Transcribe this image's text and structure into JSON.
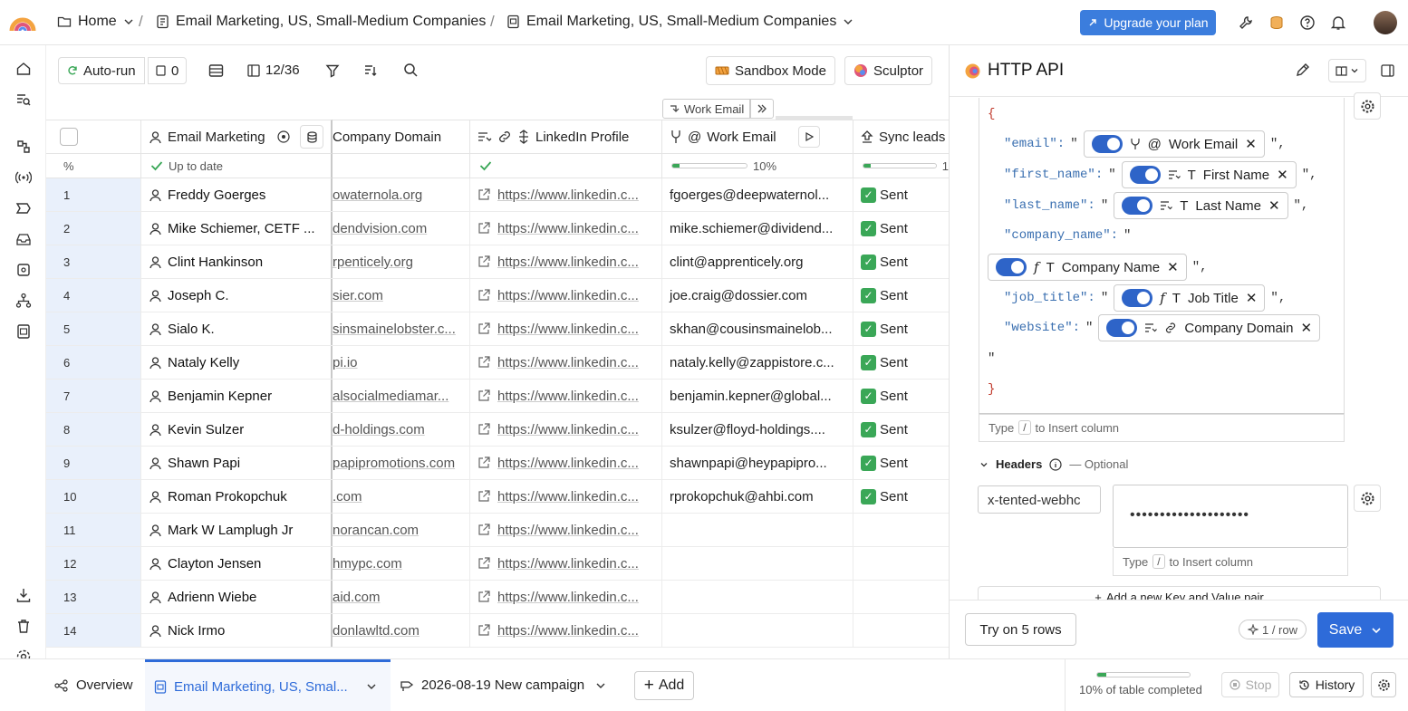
{
  "breadcrumb": {
    "home": "Home",
    "workbook": "Email Marketing, US, Small-Medium Companies",
    "table": "Email Marketing, US, Small-Medium Companies",
    "separator": "/"
  },
  "header": {
    "upgrade_label": "Upgrade your plan"
  },
  "toolbar": {
    "autorun_label": "Auto-run",
    "count_value": "0",
    "columns_label": "12/36",
    "sandbox_label": "Sandbox Mode",
    "sculptor_label": "Sculptor"
  },
  "grid": {
    "float_label": "Work Email",
    "columns": [
      {
        "key": "name",
        "label": "Email Marketing"
      },
      {
        "key": "domain",
        "label": "Company Domain"
      },
      {
        "key": "linkedin",
        "label": "LinkedIn Profile"
      },
      {
        "key": "email",
        "label": "Work Email"
      },
      {
        "key": "sync",
        "label": "Sync leads"
      }
    ],
    "status": {
      "rownum": "%",
      "name": "Up to date",
      "email_percent": "10%",
      "email_fraction": 0.1,
      "sync_fraction": 0.1,
      "sync_text": "1"
    },
    "rows": [
      {
        "n": "1",
        "name": "Freddy Goerges",
        "domain": "owaternola.org",
        "linkedin": "https://www.linkedin.c...",
        "email": "fgoerges@deepwaternol...",
        "sync": "Sent"
      },
      {
        "n": "2",
        "name": "Mike Schiemer, CETF ...",
        "domain": "dendvision.com",
        "linkedin": "https://www.linkedin.c...",
        "email": "mike.schiemer@dividend...",
        "sync": "Sent"
      },
      {
        "n": "3",
        "name": "Clint Hankinson",
        "domain": "rpenticely.org",
        "linkedin": "https://www.linkedin.c...",
        "email": "clint@apprenticely.org",
        "sync": "Sent"
      },
      {
        "n": "4",
        "name": "Joseph C.",
        "domain": "sier.com",
        "linkedin": "https://www.linkedin.c...",
        "email": "joe.craig@dossier.com",
        "sync": "Sent"
      },
      {
        "n": "5",
        "name": "Sialo K.",
        "domain": "sinsmainelobster.c...",
        "linkedin": "https://www.linkedin.c...",
        "email": "skhan@cousinsmainelob...",
        "sync": "Sent"
      },
      {
        "n": "6",
        "name": "Nataly Kelly",
        "domain": "pi.io",
        "linkedin": "https://www.linkedin.c...",
        "email": "nataly.kelly@zappistore.c...",
        "sync": "Sent"
      },
      {
        "n": "7",
        "name": "Benjamin Kepner",
        "domain": "alsocialmediamar...",
        "linkedin": "https://www.linkedin.c...",
        "email": "benjamin.kepner@global...",
        "sync": "Sent"
      },
      {
        "n": "8",
        "name": "Kevin Sulzer",
        "domain": "d-holdings.com",
        "linkedin": "https://www.linkedin.c...",
        "email": "ksulzer@floyd-holdings....",
        "sync": "Sent"
      },
      {
        "n": "9",
        "name": "Shawn Papi",
        "domain": "papipromotions.com",
        "linkedin": "https://www.linkedin.c...",
        "email": "shawnpapi@heypapipro...",
        "sync": "Sent"
      },
      {
        "n": "10",
        "name": "Roman Prokopchuk",
        "domain": ".com",
        "linkedin": "https://www.linkedin.c...",
        "email": "rprokopchuk@ahbi.com",
        "sync": "Sent"
      },
      {
        "n": "11",
        "name": "Mark W Lamplugh Jr",
        "domain": "norancan.com",
        "linkedin": "https://www.linkedin.c...",
        "email": "",
        "sync": ""
      },
      {
        "n": "12",
        "name": "Clayton Jensen",
        "domain": "hmypc.com",
        "linkedin": "https://www.linkedin.c...",
        "email": "",
        "sync": ""
      },
      {
        "n": "13",
        "name": "Adrienn Wiebe",
        "domain": "aid.com",
        "linkedin": "https://www.linkedin.c...",
        "email": "",
        "sync": ""
      },
      {
        "n": "14",
        "name": "Nick Irmo",
        "domain": "donlawltd.com",
        "linkedin": "https://www.linkedin.c...",
        "email": "",
        "sync": ""
      }
    ]
  },
  "panel": {
    "title": "HTTP API",
    "body": {
      "open_brace": "{",
      "close_brace": "}",
      "stray_quote": "\"",
      "fields": [
        {
          "key": "\"email\":",
          "column": "Work Email"
        },
        {
          "key": "\"first_name\":",
          "column": "First Name"
        },
        {
          "key": "\"last_name\":",
          "column": "Last Name"
        },
        {
          "key": "\"company_name\":",
          "column": "Company Name"
        },
        {
          "key": "\"job_title\":",
          "column": "Job Title"
        },
        {
          "key": "\"website\":",
          "column": "Company Domain"
        }
      ],
      "open_quote": "\"",
      "close_quote": "\",",
      "website_close_quote": "\"",
      "hint_type": "Type",
      "hint_key": "/",
      "hint_rest": "to Insert column"
    },
    "headers": {
      "label": "Headers",
      "optional": "— Optional",
      "key_value": "x-tented-webhc",
      "value_mask": "••••••••••••••••••••",
      "add_pair": "Add a new Key and Value pair"
    },
    "footer": {
      "try_label": "Try on 5 rows",
      "rate_label": "1 / row",
      "save_label": "Save"
    }
  },
  "bottom": {
    "overview": "Overview",
    "active_tab": "Email Marketing, US, Smal...",
    "campaign_tab": "2026-08-19 New campaign",
    "add_label": "Add",
    "progress_fraction": 0.1,
    "progress_text": "10% of table completed",
    "stop_label": "Stop",
    "history_label": "History"
  },
  "colors": {
    "accent": "#3b7ddd",
    "success": "#3aa757",
    "row_highlight": "#e9f0fb"
  }
}
